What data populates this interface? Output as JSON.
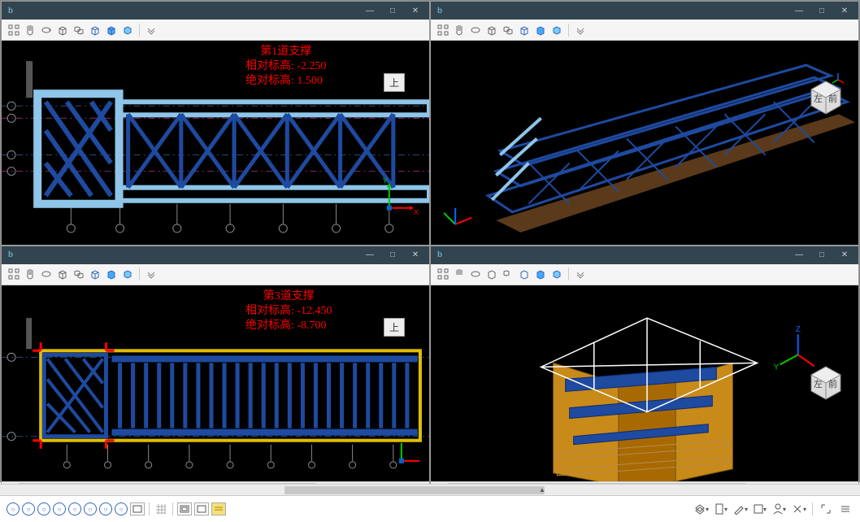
{
  "app_logo_text": "b",
  "window_controls": {
    "min": "—",
    "max": "□",
    "close": "✕"
  },
  "toolbar_icons": [
    "tool-grid",
    "tool-pan",
    "tool-undo",
    "tool-box",
    "tool-boxes",
    "tool-cube-wire",
    "tool-cube-blue",
    "tool-cube-small",
    "tool-divider",
    "tool-more"
  ],
  "panels": [
    {
      "id": "top-left",
      "annotation": {
        "title": "第1道支撑",
        "rel_label": "相对标高:",
        "rel_val": "-2.250",
        "abs_label": "绝对标高:",
        "abs_val": "1.500"
      },
      "view_label": "上"
    },
    {
      "id": "top-right",
      "viewcube_label": "左",
      "viewcube_label2": "前"
    },
    {
      "id": "bottom-left",
      "annotation": {
        "title": "第3道支撑",
        "rel_label": "相对标高:",
        "rel_val": "-12.450",
        "abs_label": "绝对标高:",
        "abs_val": "-8.700"
      },
      "view_label": "上"
    },
    {
      "id": "bottom-right",
      "viewcube_label": "左",
      "viewcube_label2": "前"
    }
  ],
  "axis": {
    "x": "X",
    "y": "Y",
    "z": "Z"
  },
  "bottom_dropdowns": [
    "▾",
    "▾",
    "▾",
    "▾",
    "▾",
    "▾"
  ]
}
